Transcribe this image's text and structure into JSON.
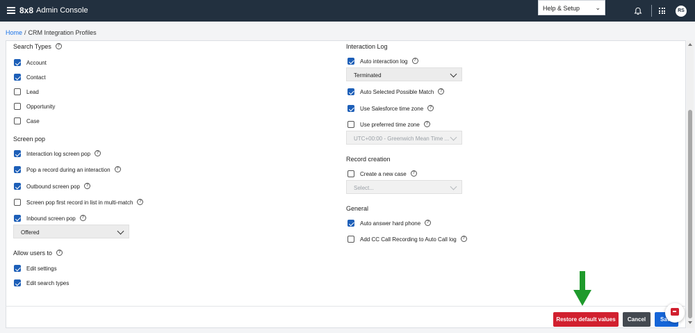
{
  "header": {
    "logo": "8x8",
    "title": "Admin Console",
    "help_setup": "Help & Setup",
    "avatar_initials": "RS"
  },
  "breadcrumb": {
    "home": "Home",
    "separator": "/",
    "current": "CRM Integration Profiles"
  },
  "left": {
    "search_types": {
      "title": "Search Types",
      "items": [
        {
          "label": "Account",
          "checked": true
        },
        {
          "label": "Contact",
          "checked": true
        },
        {
          "label": "Lead",
          "checked": false
        },
        {
          "label": "Opportunity",
          "checked": false
        },
        {
          "label": "Case",
          "checked": false
        }
      ]
    },
    "screen_pop": {
      "title": "Screen pop",
      "items": [
        {
          "label": "Interaction log screen pop",
          "checked": true,
          "help": true
        },
        {
          "label": "Pop a record during an interaction",
          "checked": true,
          "help": true
        },
        {
          "label": "Outbound screen pop",
          "checked": true,
          "help": true
        },
        {
          "label": "Screen pop first record in list in multi-match",
          "checked": false,
          "help": true
        },
        {
          "label": "Inbound screen pop",
          "checked": true,
          "help": true
        }
      ],
      "dropdown_value": "Offered"
    },
    "allow_users": {
      "title": "Allow users to",
      "items": [
        {
          "label": "Edit settings",
          "checked": true
        },
        {
          "label": "Edit search types",
          "checked": true
        }
      ]
    }
  },
  "right": {
    "interaction_log": {
      "title": "Interaction Log",
      "auto_log": {
        "label": "Auto interaction log",
        "checked": true
      },
      "auto_log_dropdown": "Terminated",
      "auto_match": {
        "label": "Auto Selected Possible Match",
        "checked": true
      },
      "sf_timezone": {
        "label": "Use Salesforce time zone",
        "checked": true
      },
      "pref_timezone": {
        "label": "Use preferred time zone",
        "checked": false
      },
      "timezone_dropdown": "UTC+00:00 - Greenwich Mean Time ..."
    },
    "record_creation": {
      "title": "Record creation",
      "create_case": {
        "label": "Create a new case",
        "checked": false
      },
      "case_dropdown": "Select..."
    },
    "general": {
      "title": "General",
      "auto_answer": {
        "label": "Auto answer hard phone",
        "checked": true
      },
      "cc_recording": {
        "label": "Add CC Call Recording to Auto Call log",
        "checked": false
      }
    }
  },
  "footer": {
    "restore": "Restore default values",
    "cancel": "Cancel",
    "save": "Save"
  },
  "colors": {
    "topbar": "#22303f",
    "checkbox": "#1d5fb8",
    "restore_button": "#d1202f",
    "cancel_button": "#444950",
    "save_button": "#1565d8",
    "arrow": "#1f9a2c"
  }
}
